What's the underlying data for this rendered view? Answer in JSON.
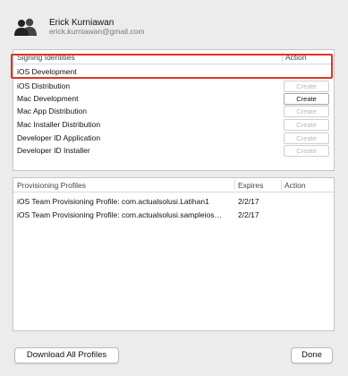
{
  "account": {
    "name": "Erick Kurniawan",
    "email": "erick.kurniawan@gmail.com",
    "icon": "account-icon"
  },
  "signing": {
    "header_name": "Signing Identities",
    "header_action": "Action",
    "rows": [
      {
        "label": "iOS Development"
      },
      {
        "label": "iOS Distribution",
        "action": "Create",
        "enabled": false
      },
      {
        "label": "Mac Development",
        "action": "Create",
        "enabled": true
      },
      {
        "label": "Mac App Distribution",
        "action": "Create",
        "enabled": false
      },
      {
        "label": "Mac Installer Distribution",
        "action": "Create",
        "enabled": false
      },
      {
        "label": "Developer ID Application",
        "action": "Create",
        "enabled": false
      },
      {
        "label": "Developer ID Installer",
        "action": "Create",
        "enabled": false
      }
    ]
  },
  "profiles": {
    "header_name": "Provisioning Profiles",
    "header_expires": "Expires",
    "header_action": "Action",
    "rows": [
      {
        "name": "iOS Team Provisioning Profile: com.actualsolusi.Latihan1",
        "expires": "2/2/17"
      },
      {
        "name": "iOS Team Provisioning Profile: com.actualsolusi.sampleios…",
        "expires": "2/2/17"
      }
    ]
  },
  "footer": {
    "download_label": "Download All Profiles",
    "done_label": "Done"
  },
  "colors": {
    "highlight": "#e53024"
  }
}
